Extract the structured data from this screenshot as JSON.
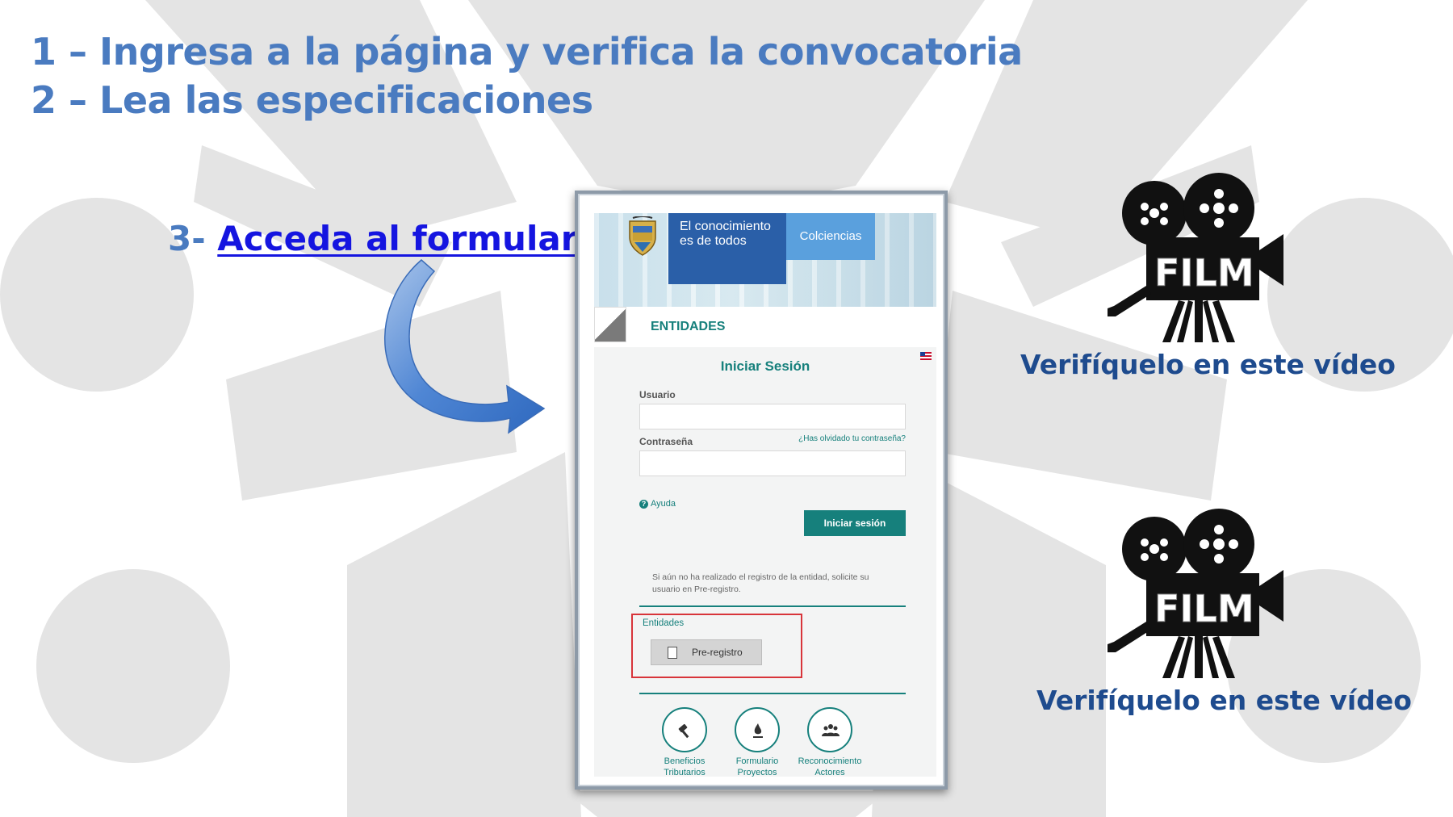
{
  "steps": {
    "step1": "1 – Ingresa a la página y verifica la convocatoria",
    "step2": "2 – Lea las especificaciones",
    "step3_number": "3-",
    "step3_link": "Acceda al formulario"
  },
  "screenshot": {
    "banner_line1": "El conocimiento",
    "banner_line2": "es de todos",
    "banner_brand": "Colciencias",
    "section_title": "ENTIDADES",
    "login_title": "Iniciar Sesión",
    "username_label": "Usuario",
    "password_label": "Contraseña",
    "forgot_link": "¿Has olvidado tu contraseña?",
    "help_link": "Ayuda",
    "login_button": "Iniciar sesión",
    "prereg_note": "Si aún no ha realizado el registro de la entidad, solicite su usuario en Pre-registro.",
    "entities_label": "Entidades",
    "prereg_button": "Pre-registro",
    "shortcuts": [
      {
        "line1": "Beneficios",
        "line2": "Tributarios",
        "icon": "gavel-icon"
      },
      {
        "line1": "Formulario",
        "line2": "Proyectos",
        "icon": "flame-icon"
      },
      {
        "line1": "Reconocimiento",
        "line2": "Actores",
        "icon": "group-icon"
      }
    ]
  },
  "videos": [
    {
      "label": "Verifíquelo en este vídeo",
      "camera_text": "FILM",
      "icon": "film-camera-icon"
    },
    {
      "label": "Verifíquelo en este vídeo",
      "camera_text": "FILM",
      "icon": "film-camera-icon"
    }
  ],
  "colors": {
    "heading": "#4a7bc0",
    "link": "#1515e0",
    "video_label": "#1e4b8e",
    "teal": "#16807c",
    "highlight": "#d8343a"
  }
}
